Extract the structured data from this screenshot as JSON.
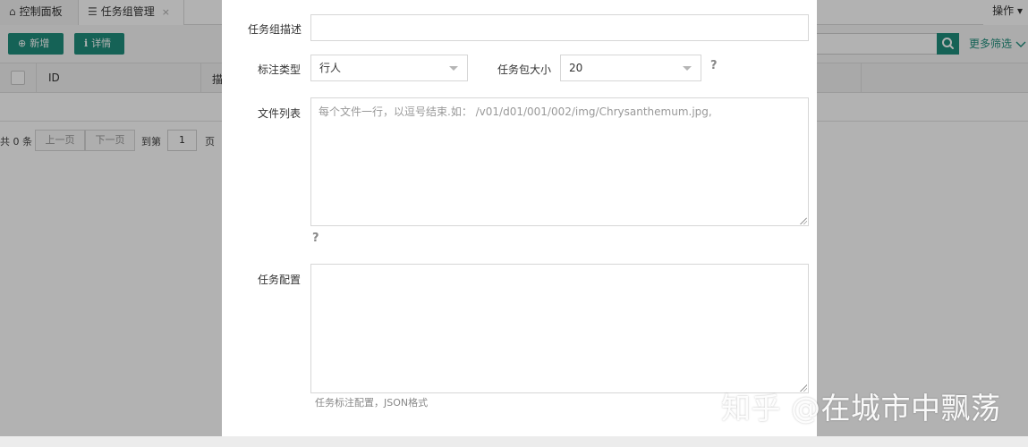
{
  "tabs": {
    "home_label": "控制面板",
    "active_label": "任务组管理",
    "close_symbol": "×",
    "operations_label": "操作"
  },
  "toolbar": {
    "add_label": "新增",
    "detail_label": "详情",
    "more_filter_label": "更多筛选"
  },
  "table": {
    "columns": [
      "ID",
      "描"
    ]
  },
  "pager": {
    "total_text": "共 0 条",
    "prev_label": "上一页",
    "next_label": "下一页",
    "goto_label": "到第",
    "page_value": "1",
    "page_unit": "页"
  },
  "modal": {
    "desc_label": "任务组描述",
    "type_label": "标注类型",
    "type_value": "行人",
    "size_label": "任务包大小",
    "size_value": "20",
    "help_symbol": "?",
    "files_label": "文件列表",
    "files_placeholder": "每个文件一行，以逗号结束.如： /v01/d01/001/002/img/Chrysanthemum.jpg,",
    "config_label": "任务配置",
    "config_hint": "任务标注配置，JSON格式"
  },
  "watermark": "知乎 @在城市中飘荡",
  "colors": {
    "accent": "#1f8d7b",
    "overlay": "rgba(0,0,0,0.30)"
  }
}
